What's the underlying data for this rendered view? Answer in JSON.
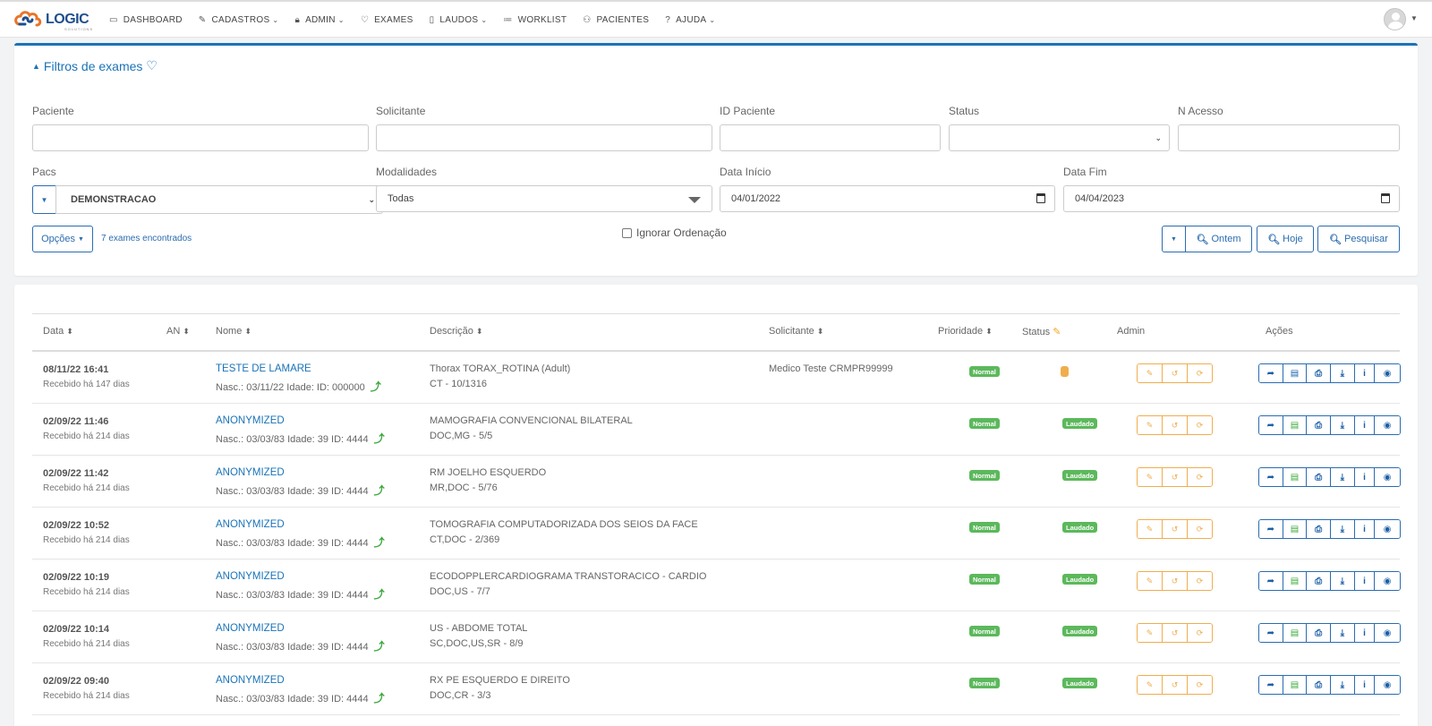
{
  "nav": {
    "logo_text": "LOGIC",
    "logo_sub": "SOLUTIONS",
    "items": [
      {
        "icon": "monitor-icon",
        "glyph": "▭",
        "label": "DASHBOARD",
        "caret": false
      },
      {
        "icon": "edit-icon",
        "glyph": "✎",
        "label": "CADASTROS",
        "caret": true
      },
      {
        "icon": "lock-icon",
        "glyph": "🔒︎",
        "label": "ADMIN",
        "caret": true
      },
      {
        "icon": "heart-icon",
        "glyph": "♡",
        "label": "EXAMES",
        "caret": false
      },
      {
        "icon": "file-icon",
        "glyph": "▯",
        "label": "LAUDOS",
        "caret": true
      },
      {
        "icon": "list-icon",
        "glyph": "≔",
        "label": "WORKLIST",
        "caret": false
      },
      {
        "icon": "users-icon",
        "glyph": "⚇",
        "label": "PACIENTES",
        "caret": false
      },
      {
        "icon": "question-icon",
        "glyph": "?",
        "label": "AJUDA",
        "caret": true
      }
    ]
  },
  "filters": {
    "title": "Filtros de exames",
    "labels": {
      "paciente": "Paciente",
      "solicitante": "Solicitante",
      "id_paciente": "ID Paciente",
      "status": "Status",
      "n_acesso": "N Acesso",
      "pacs": "Pacs",
      "modalidades": "Modalidades",
      "data_inicio": "Data Início",
      "data_fim": "Data Fim"
    },
    "values": {
      "paciente": "",
      "solicitante": "",
      "id_paciente": "",
      "status": "",
      "n_acesso": "",
      "pacs": "DEMONSTRACAO",
      "modalidades": "Todas",
      "data_inicio": "04/01/2022",
      "data_fim": "04/04/2023"
    },
    "opcoes_label": "Opções",
    "found_text": "7 exames encontrados",
    "ignorar_label": "Ignorar Ordenação",
    "btn_ontem": "Ontem",
    "btn_hoje": "Hoje",
    "btn_pesquisar": "Pesquisar"
  },
  "table": {
    "headers": {
      "data": "Data",
      "an": "AN",
      "nome": "Nome",
      "descricao": "Descrição",
      "solicitante": "Solicitante",
      "prioridade": "Prioridade",
      "status": "Status",
      "admin": "Admin",
      "acoes": "Ações"
    },
    "rows": [
      {
        "date": "08/11/22 16:41",
        "received": "Recebido há 147 dias",
        "name": "TESTE DE LAMARE",
        "nasc": "Nasc.: 03/11/22 Idade: ID: 000000",
        "desc": "Thorax TORAX_ROTINA (Adult)",
        "desc2": "CT - 10/1316",
        "solicitante": "Medico Teste CRMPR99999",
        "priority": "Normal",
        "status": "",
        "status_pending": true
      },
      {
        "date": "02/09/22 11:46",
        "received": "Recebido há 214 dias",
        "name": "ANONYMIZED",
        "nasc": "Nasc.: 03/03/83 Idade: 39 ID: 4444",
        "desc": "MAMOGRAFIA CONVENCIONAL BILATERAL",
        "desc2": "DOC,MG - 5/5",
        "solicitante": "",
        "priority": "Normal",
        "status": "Laudado",
        "status_pending": false
      },
      {
        "date": "02/09/22 11:42",
        "received": "Recebido há 214 dias",
        "name": "ANONYMIZED",
        "nasc": "Nasc.: 03/03/83 Idade: 39 ID: 4444",
        "desc": "RM JOELHO ESQUERDO",
        "desc2": "MR,DOC - 5/76",
        "solicitante": "",
        "priority": "Normal",
        "status": "Laudado",
        "status_pending": false
      },
      {
        "date": "02/09/22 10:52",
        "received": "Recebido há 214 dias",
        "name": "ANONYMIZED",
        "nasc": "Nasc.: 03/03/83 Idade: 39 ID: 4444",
        "desc": "TOMOGRAFIA COMPUTADORIZADA DOS SEIOS DA FACE",
        "desc2": "CT,DOC - 2/369",
        "solicitante": "",
        "priority": "Normal",
        "status": "Laudado",
        "status_pending": false
      },
      {
        "date": "02/09/22 10:19",
        "received": "Recebido há 214 dias",
        "name": "ANONYMIZED",
        "nasc": "Nasc.: 03/03/83 Idade: 39 ID: 4444",
        "desc": "ECODOPPLERCARDIOGRAMA TRANSTORACICO - CARDIO",
        "desc2": "DOC,US - 7/7",
        "solicitante": "",
        "priority": "Normal",
        "status": "Laudado",
        "status_pending": false
      },
      {
        "date": "02/09/22 10:14",
        "received": "Recebido há 214 dias",
        "name": "ANONYMIZED",
        "nasc": "Nasc.: 03/03/83 Idade: 39 ID: 4444",
        "desc": "US - ABDOME TOTAL",
        "desc2": "SC,DOC,US,SR - 8/9",
        "solicitante": "",
        "priority": "Normal",
        "status": "Laudado",
        "status_pending": false
      },
      {
        "date": "02/09/22 09:40",
        "received": "Recebido há 214 dias",
        "name": "ANONYMIZED",
        "nasc": "Nasc.: 03/03/83 Idade: 39 ID: 4444",
        "desc": "RX PE ESQUERDO E DIREITO",
        "desc2": "DOC,CR - 3/3",
        "solicitante": "",
        "priority": "Normal",
        "status": "Laudado",
        "status_pending": false
      }
    ]
  },
  "colors": {
    "primary": "#1a73b8",
    "warning": "#f0ad4e",
    "success": "#5cb85c"
  }
}
